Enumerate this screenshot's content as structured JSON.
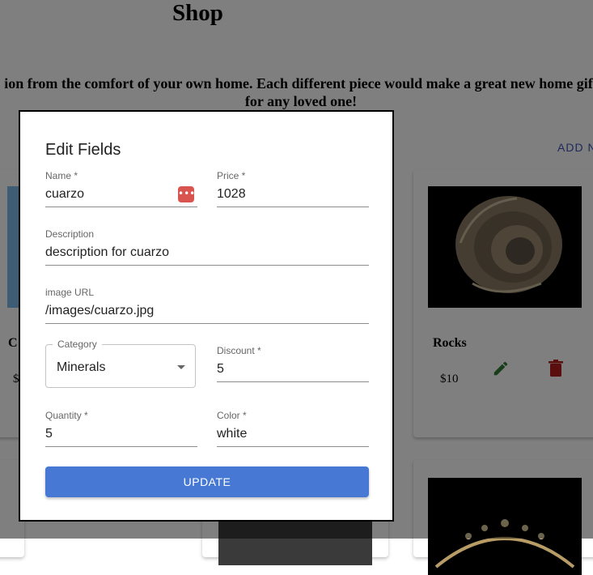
{
  "page": {
    "title": "Shop",
    "intro": "ion from the comfort of your own home. Each different piece would make a great new home gift for any loved one!",
    "add_new": "ADD N"
  },
  "cards": {
    "left_partial": {
      "name": "C",
      "price": "$"
    },
    "rocks": {
      "name": "Rocks",
      "price": "$10"
    }
  },
  "colors": {
    "accent": "#4779d4",
    "edit": "#2e7d32",
    "delete": "#b71c1c",
    "link": "#3f51b5"
  },
  "icons": {
    "edit": "pencil-icon",
    "delete": "trash-icon",
    "password_manager": "password-manager-icon",
    "dropdown": "chevron-down-icon"
  },
  "dialog": {
    "title": "Edit Fields",
    "fields": {
      "name": {
        "label": "Name *",
        "value": "cuarzo"
      },
      "price": {
        "label": "Price *",
        "value": "1028"
      },
      "description": {
        "label": "Description",
        "value": "description for cuarzo"
      },
      "image_url": {
        "label": "image URL",
        "value": "/images/cuarzo.jpg"
      },
      "category": {
        "label": "Category",
        "value": "Minerals"
      },
      "discount": {
        "label": "Discount *",
        "value": "5"
      },
      "quantity": {
        "label": "Quantity *",
        "value": "5"
      },
      "color": {
        "label": "Color *",
        "value": "white"
      }
    },
    "update_label": "UPDATE"
  }
}
